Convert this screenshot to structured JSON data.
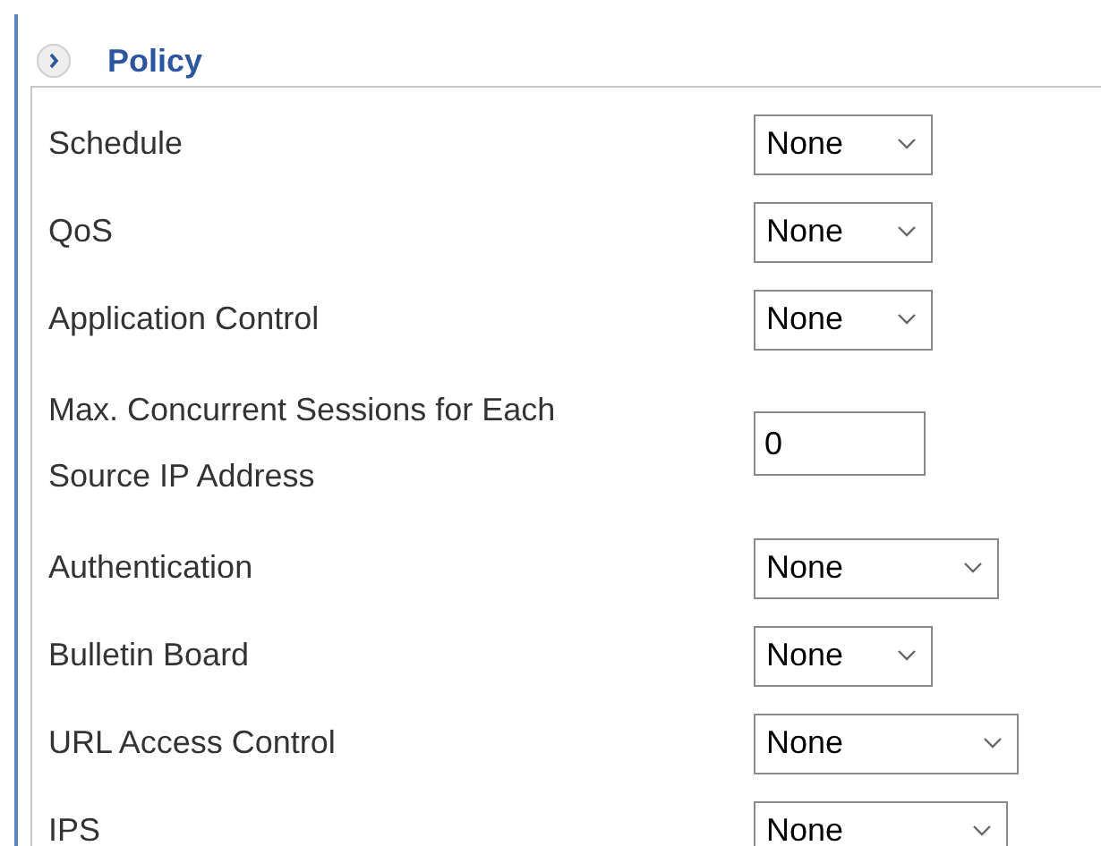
{
  "section": {
    "title": "Policy",
    "expanded": false
  },
  "rows": [
    {
      "label": "Schedule",
      "kind": "select",
      "value": "None"
    },
    {
      "label": "QoS",
      "kind": "select",
      "value": "None"
    },
    {
      "label": "Application Control",
      "kind": "select",
      "value": "None"
    },
    {
      "label": "Max. Concurrent Sessions for Each Source IP Address",
      "kind": "input",
      "value": "0"
    },
    {
      "label": "Authentication",
      "kind": "select",
      "value": "None"
    },
    {
      "label": "Bulletin Board",
      "kind": "select",
      "value": "None"
    },
    {
      "label": "URL Access Control",
      "kind": "select",
      "value": "None"
    },
    {
      "label": "IPS",
      "kind": "select",
      "value": "None"
    }
  ]
}
